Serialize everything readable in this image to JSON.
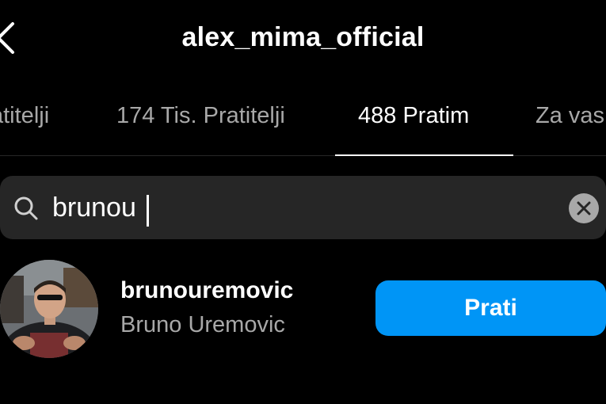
{
  "header": {
    "title": "alex_mima_official",
    "back_icon": "chevron-left-icon"
  },
  "tabs": [
    {
      "label": "atitelji"
    },
    {
      "label": "174 Tis. Pratitelji"
    },
    {
      "label": "488 Pratim",
      "active": true
    },
    {
      "label": "Za vas"
    }
  ],
  "search": {
    "value": "brunou",
    "placeholder": "",
    "icon": "search-icon",
    "clear_icon": "clear-icon"
  },
  "result": {
    "username": "brunouremovic",
    "full_name": "Bruno Uremovic",
    "follow_label": "Prati"
  },
  "colors": {
    "background": "#000000",
    "search_bg": "#262626",
    "secondary_text": "#a8a8a8",
    "accent": "#0095f6"
  }
}
